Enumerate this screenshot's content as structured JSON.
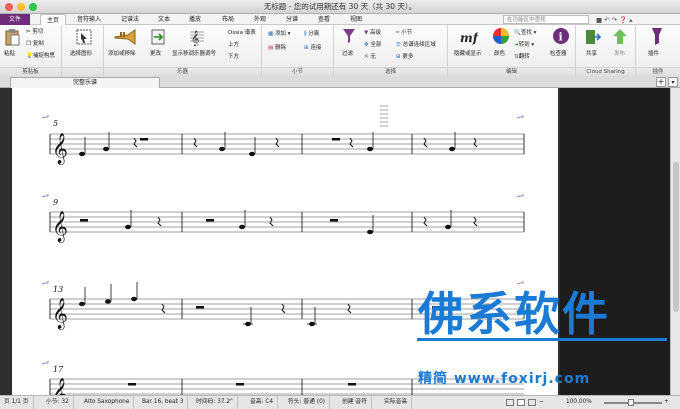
{
  "window": {
    "title": "无标题 - 您的试用期还有 30 天（共 30 天）。"
  },
  "menu": {
    "tabs": [
      "文件",
      "主页",
      "音符输入",
      "记谱法",
      "文本",
      "播放",
      "布局",
      "外观",
      "分谱",
      "查看",
      "视图"
    ],
    "search_placeholder": "在功能区中查找"
  },
  "ribbon": {
    "clipboard": {
      "label": "剪贴板",
      "paste": "粘贴",
      "cut": "剪切",
      "copy": "复制",
      "capture": "捕捉构思"
    },
    "select_graphic": "选择图形",
    "instruments": {
      "label": "乐器",
      "add_remove": "添加或移除",
      "change": "更改",
      "show_transposing": "显示移调乐器调号",
      "ossia": "Ossia 谱表",
      "above": "上方",
      "below": "下方"
    },
    "bars": {
      "label": "小节",
      "add": "添加",
      "split": "分离",
      "delete": "删除",
      "join": "连接"
    },
    "selection": {
      "label": "选择",
      "filter": "过滤",
      "advanced": "高级",
      "all": "全部",
      "none": "无",
      "bar": "小节",
      "system_passage": "总谱连续区域",
      "more": "更多"
    },
    "edit": {
      "label": "编辑",
      "hide_show": "隐藏或显示",
      "color": "颜色",
      "find": "查找",
      "goto": "转到",
      "flip": "翻转",
      "inspector": "检查器"
    },
    "cloud": {
      "label": "Cloud Sharing",
      "share": "共享",
      "publish": "发布"
    },
    "plugins": {
      "label": "插件",
      "plugin": "插件"
    }
  },
  "document": {
    "tab": "完整乐谱"
  },
  "score": {
    "bar_numbers": [
      "5",
      "9",
      "13",
      "17"
    ]
  },
  "status": {
    "page": "页 1/1 页",
    "bars": "小节: 32",
    "instrument": "Alto Saxophone",
    "position": "Bar 16, beat 3",
    "time": "时间码: 37.2\"",
    "pitch": "音高: C4",
    "accidental": "符头: 普通 (0)",
    "create": "创建 音符",
    "concert": "实际音高",
    "zoom": "100.00%"
  },
  "watermark": {
    "brand": "佛系软件",
    "sub": "精简 www.foxirj.com"
  },
  "colors": {
    "file_tab": "#6e2c7a",
    "watermark": "#1a7ad4"
  }
}
